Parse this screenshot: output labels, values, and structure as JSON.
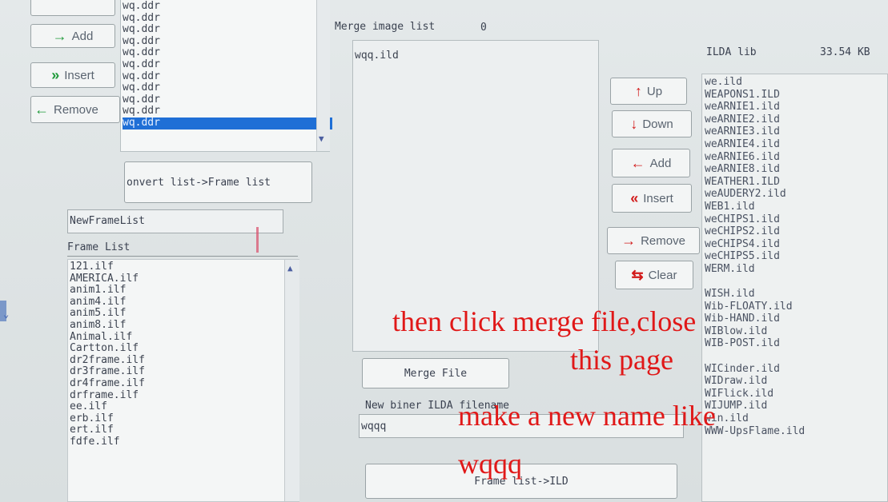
{
  "colors": {
    "annotation": "#e01818",
    "up_arrow": "#d21a1a",
    "add_arrow": "#1f9a3a",
    "selection": "#1f6fd6"
  },
  "top_list": {
    "items": [
      "wq.ddr",
      "wq.ddr",
      "wq.ddr",
      "wq.ddr",
      "wq.ddr",
      "wq.ddr",
      "wq.ddr",
      "wq.ddr",
      "wq.ddr",
      "wq.ddr",
      "wq.ddr"
    ],
    "selected_index": 10
  },
  "left_buttons": {
    "add": "Add",
    "insert": "Insert",
    "remove": "Remove"
  },
  "convert_button": "onvert list->Frame list",
  "frame_name_input": "NewFrameList",
  "frame_list": {
    "label": "Frame List",
    "items": [
      "121.ilf",
      "AMERICA.ilf",
      "anim1.ilf",
      "anim4.ilf",
      "anim5.ilf",
      "anim8.ilf",
      "Animal.ilf",
      "Cartton.ilf",
      "dr2frame.ilf",
      "dr3frame.ilf",
      "dr4frame.ilf",
      "drframe.ilf",
      "ee.ilf",
      "erb.ilf",
      "ert.ilf",
      "fdfe.ilf"
    ]
  },
  "merge": {
    "label": "Merge image list",
    "count": "0",
    "items": [
      "wqq.ild"
    ],
    "merge_button": "Merge File"
  },
  "middle_buttons": {
    "up": "Up",
    "down": "Down",
    "add": "Add",
    "insert": "Insert",
    "remove": "Remove",
    "clear": "Clear"
  },
  "new_name": {
    "label": "New biner ILDA filename",
    "value": "wqqq"
  },
  "bottom_button": "Frame list->ILD",
  "ilda": {
    "label": "ILDA lib",
    "size": "33.54 KB",
    "items": [
      "we.ild",
      "WEAPONS1.ILD",
      "weARNIE1.ild",
      "weARNIE2.ild",
      "weARNIE3.ild",
      "weARNIE4.ild",
      "weARNIE6.ild",
      "weARNIE8.ild",
      "WEATHER1.ILD",
      "weAUDERY2.ild",
      "WEB1.ild",
      "weCHIPS1.ild",
      "weCHIPS2.ild",
      "weCHIPS4.ild",
      "weCHIPS5.ild",
      "WERM.ild",
      "",
      "WISH.ild",
      "Wib-FLOATY.ild",
      "Wib-HAND.ild",
      "WIBlow.ild",
      "WIB-POST.ild",
      "",
      "WICinder.ild",
      "WIDraw.ild",
      "WIFlick.ild",
      "WIJUMP.ild",
      "win.ild",
      "WWW-UpsFlame.ild"
    ]
  },
  "annotations": {
    "line1": "then click merge file,close",
    "line2": "this page",
    "line3": "make a new name like",
    "line4": "wqqq"
  }
}
